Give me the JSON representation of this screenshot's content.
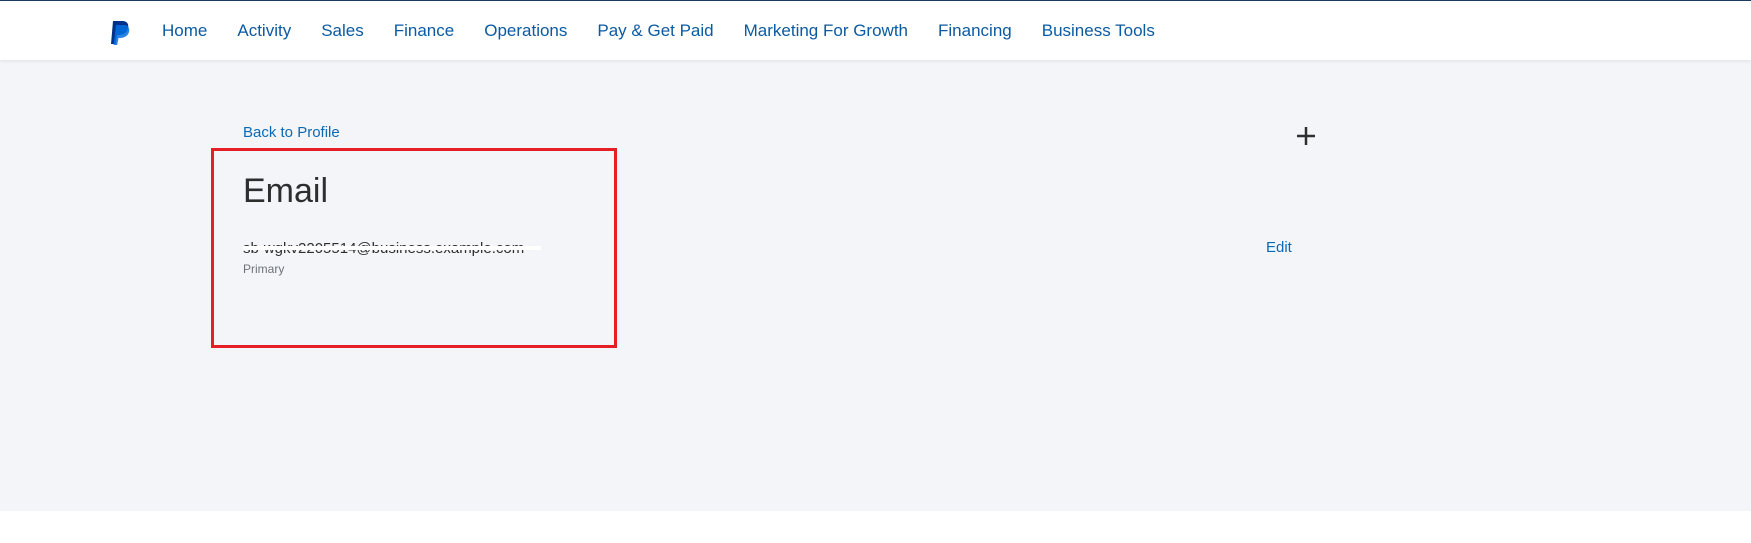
{
  "header": {
    "logo_icon": "paypal-logo-icon",
    "nav": [
      {
        "label": "Home"
      },
      {
        "label": "Activity"
      },
      {
        "label": "Sales"
      },
      {
        "label": "Finance"
      },
      {
        "label": "Operations"
      },
      {
        "label": "Pay & Get Paid"
      },
      {
        "label": "Marketing For Growth"
      },
      {
        "label": "Financing"
      },
      {
        "label": "Business Tools"
      }
    ]
  },
  "main": {
    "back_link": "Back to Profile",
    "add_icon": "plus-icon",
    "title": "Email",
    "email": {
      "value": "sb-wgkv2205514@business.example.com",
      "status": "Primary",
      "edit_label": "Edit"
    }
  },
  "colors": {
    "nav_text": "#0b5aa2",
    "link": "#0b6ab5",
    "page_bg": "#f4f5f8",
    "highlight": "#e61e25"
  }
}
